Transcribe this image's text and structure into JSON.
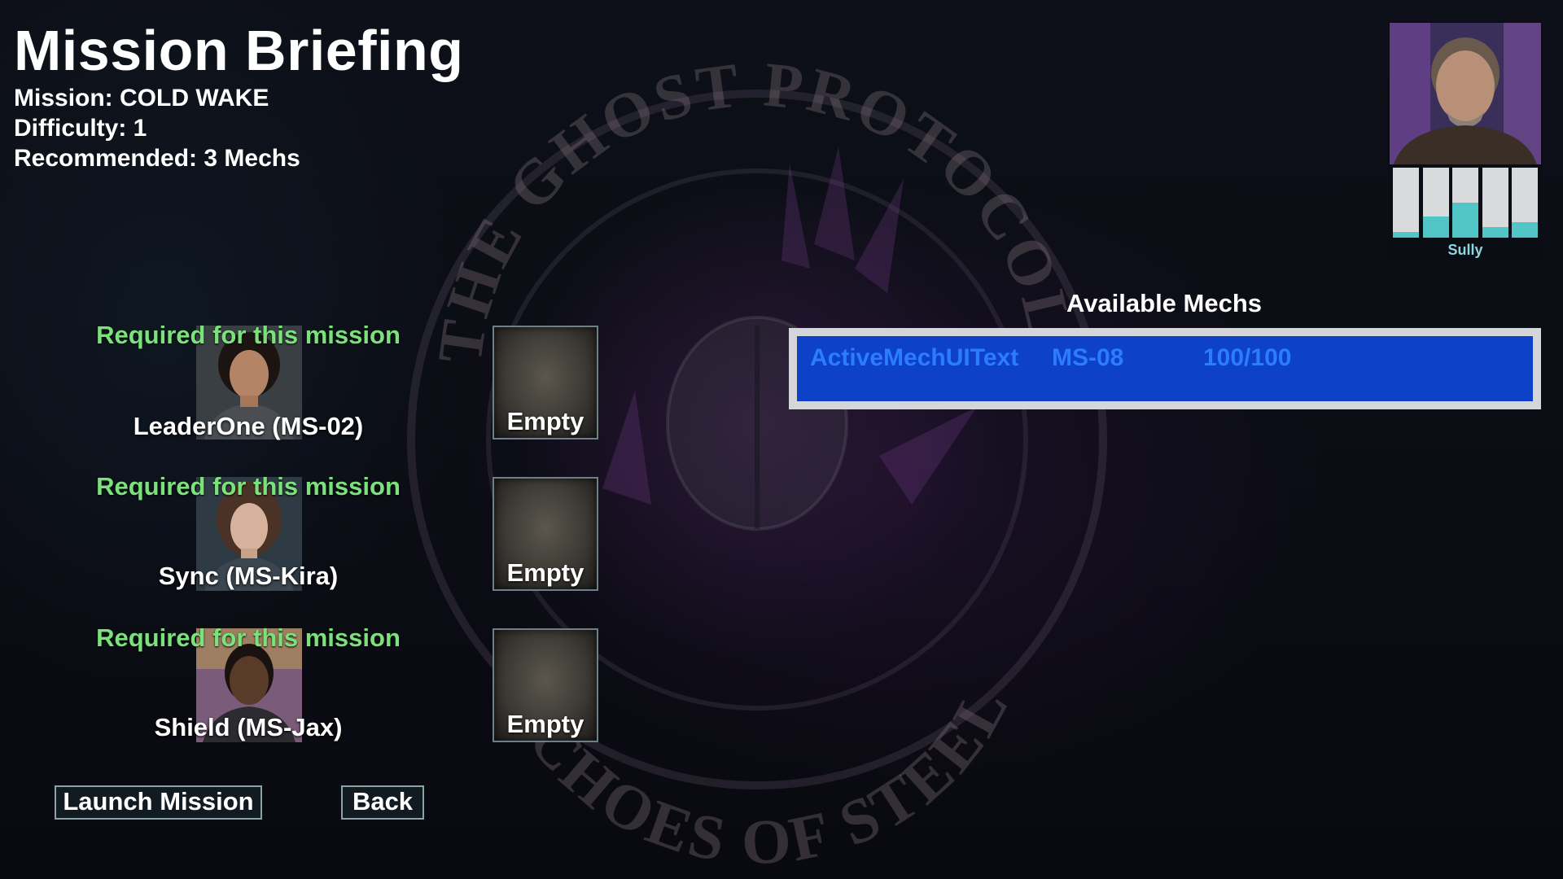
{
  "header": {
    "title": "Mission Briefing",
    "mission": "Mission: COLD WAKE",
    "difficulty": "Difficulty: 1",
    "recommended": "Recommended: 3 Mechs"
  },
  "emblem": {
    "top_text": "THE GHOST PROTOCOL:",
    "bottom_text": "ECHOES OF STEEL"
  },
  "pilots": [
    {
      "required": "Required for this mission",
      "name": "LeaderOne (MS-02)",
      "slot": "Empty"
    },
    {
      "required": "Required for this mission",
      "name": "Sync (MS-Kira)",
      "slot": "Empty"
    },
    {
      "required": "Required for this mission",
      "name": "Shield (MS-Jax)",
      "slot": "Empty"
    }
  ],
  "buttons": {
    "launch": "Launch Mission",
    "back": "Back"
  },
  "available": {
    "title": "Available Mechs",
    "mechs": [
      {
        "name": "ActiveMechUIText",
        "id": "MS-08",
        "hp": "100/100"
      }
    ]
  },
  "commander": {
    "name": "Sully",
    "stat_levels": [
      0.08,
      0.3,
      0.5,
      0.15,
      0.22
    ]
  },
  "colors": {
    "required_text": "#7be27b",
    "mech_row": "#0d41c8",
    "mech_text": "#2b7cff",
    "stat_fill": "#52c6c6",
    "commander_name": "#8fd7de"
  }
}
